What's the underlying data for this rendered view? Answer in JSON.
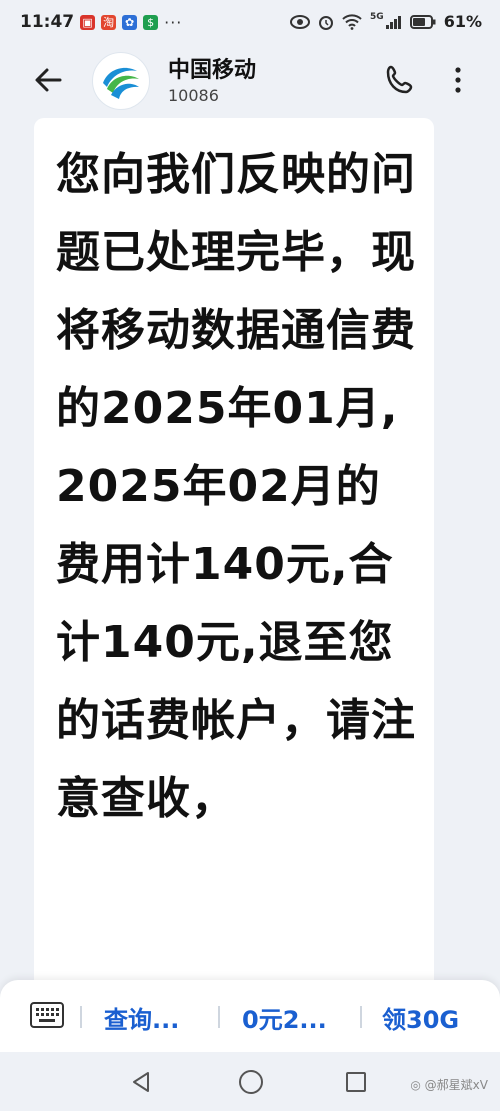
{
  "status_bar": {
    "time": "11:47",
    "network_label": "5G",
    "battery": "61%",
    "more_dots": "···"
  },
  "header": {
    "contact_name": "中国移动",
    "contact_number": "10086",
    "back_icon": "back-arrow-icon",
    "call_icon": "phone-icon",
    "more_icon": "more-vertical-icon"
  },
  "message": {
    "text": "您向我们反映的问题已处理完毕，现将移动数据通信费的2025年01月,2025年02月的费用计140元,合计140元,退至您的话费帐户，请注意查收，"
  },
  "quick_replies": {
    "keyboard_icon": "keyboard-icon",
    "items": [
      {
        "label": "查询..."
      },
      {
        "label": "0元2..."
      },
      {
        "label": "领30G"
      }
    ]
  },
  "nav": {
    "watermark": "◎ @郝星斌xV"
  },
  "colors": {
    "background": "#eef1f6",
    "bubble": "#ffffff",
    "accent": "#1a5fd0"
  }
}
